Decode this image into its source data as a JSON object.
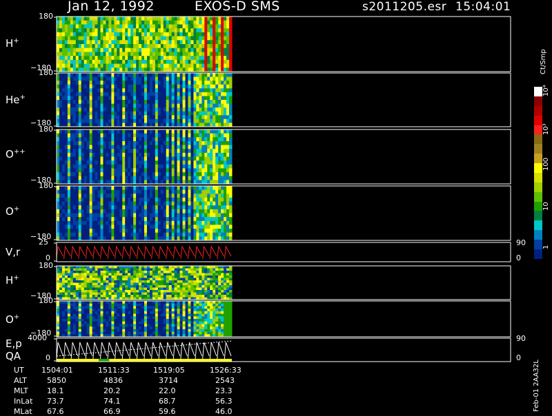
{
  "header": {
    "date": "Jan 12, 1992",
    "instrument": "EXOS-D SMS",
    "file": "s2011205.esr",
    "time": "15:04:01"
  },
  "panels": [
    {
      "label": "H",
      "sup": "+",
      "tick_top": "180",
      "tick_bottom": "−180",
      "kind": "spectrogram"
    },
    {
      "label": "He",
      "sup": "+",
      "tick_top": "180",
      "tick_bottom": "−180",
      "kind": "spectrogram"
    },
    {
      "label": "O",
      "sup": "++",
      "tick_top": "180",
      "tick_bottom": "−180",
      "kind": "spectrogram"
    },
    {
      "label": "O",
      "sup": "+",
      "tick_top": "180",
      "tick_bottom": "−180",
      "kind": "spectrogram"
    },
    {
      "label": "V,r",
      "sup": "",
      "tick_top": "25",
      "tick_bottom": "0",
      "right_top": "90",
      "right_bottom": "0",
      "kind": "line"
    },
    {
      "label": "H",
      "sup": "+",
      "tick_top": "180",
      "tick_bottom": "−180",
      "kind": "spectrogram"
    },
    {
      "label": "O",
      "sup": "+",
      "tick_top": "180",
      "tick_bottom": "−180",
      "kind": "spectrogram"
    },
    {
      "label": "E,p",
      "label2": "QA",
      "sup": "",
      "tick_top": "4000",
      "tick_bottom": "0",
      "right_top": "90",
      "right_bottom": "0",
      "kind": "line"
    }
  ],
  "colorbar": {
    "unit": "Ct/Smp",
    "labels": [
      "10⁴",
      "10³",
      "100",
      "10",
      "1"
    ],
    "colors": [
      "#ffffff",
      "#8b0000",
      "#b00000",
      "#e00000",
      "#ff2020",
      "#8b6914",
      "#a08020",
      "#c8a020",
      "#ffff00",
      "#d8e000",
      "#a0d000",
      "#60c000",
      "#20a000",
      "#008040",
      "#00c8c8",
      "#0080c0",
      "#0040a0",
      "#002080"
    ]
  },
  "bottom": {
    "rows": [
      {
        "name": "UT",
        "values": [
          "1504:01",
          "1511:33",
          "1519:05",
          "1526:33"
        ]
      },
      {
        "name": "ALT",
        "values": [
          "5850",
          "4836",
          "3714",
          "2543"
        ]
      },
      {
        "name": "MLT",
        "values": [
          "18.1",
          "20.2",
          "22.0",
          "23.3"
        ]
      },
      {
        "name": "InLat",
        "values": [
          "73.7",
          "74.1",
          "68.7",
          "56.3"
        ]
      },
      {
        "name": "MLat",
        "values": [
          "67.6",
          "66.9",
          "59.6",
          "46.0"
        ]
      }
    ],
    "side_label": "Feb-01 2AA32L"
  },
  "chart_data": {
    "type": "heatmap",
    "title": "Jan 12, 1992   EXOS-D SMS",
    "x_ticks": [
      "1504:01",
      "1511:33",
      "1519:05",
      "1526:33"
    ],
    "series": [
      {
        "name": "H+",
        "yrange": [
          -180,
          180
        ]
      },
      {
        "name": "He+",
        "yrange": [
          -180,
          180
        ]
      },
      {
        "name": "O++",
        "yrange": [
          -180,
          180
        ]
      },
      {
        "name": "O+",
        "yrange": [
          -180,
          180
        ]
      },
      {
        "name": "V,r",
        "yrange": [
          0,
          25
        ],
        "right_range": [
          0,
          90
        ]
      },
      {
        "name": "H+",
        "yrange": [
          -180,
          180
        ]
      },
      {
        "name": "O+",
        "yrange": [
          -180,
          180
        ]
      },
      {
        "name": "E,p QA",
        "yrange": [
          0,
          4000
        ],
        "right_range": [
          0,
          90
        ]
      }
    ],
    "colorscale": {
      "unit": "Ct/Smp",
      "ticks": [
        "1",
        "10",
        "100",
        "10³",
        "10⁴"
      ],
      "log": true
    }
  }
}
